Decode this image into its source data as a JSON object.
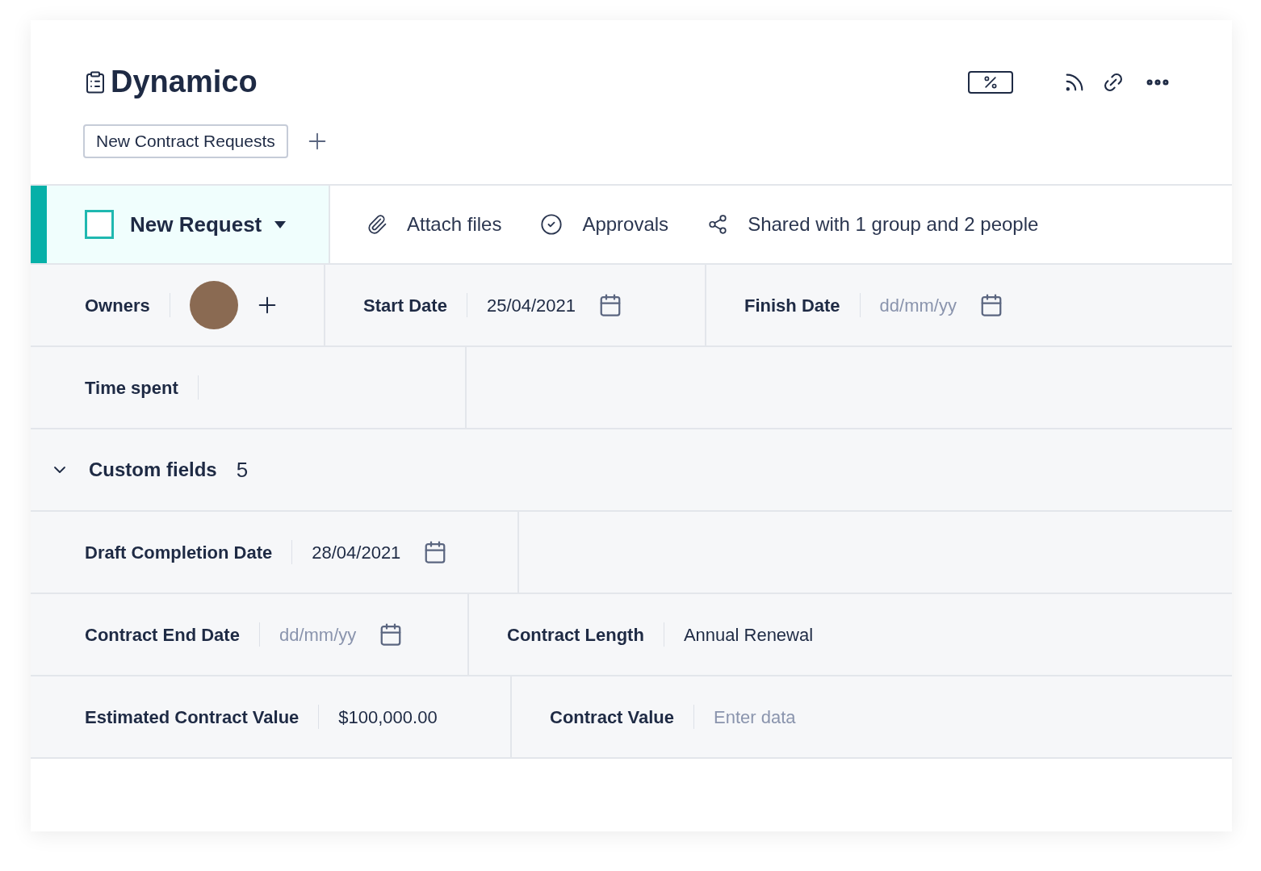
{
  "title": "Dynamico",
  "tags": [
    "New Contract Requests"
  ],
  "toolbar": {
    "checked": false,
    "status": "New Request",
    "actions": [
      {
        "kind": "attach",
        "label": "Attach files"
      },
      {
        "kind": "approvals",
        "label": "Approvals"
      },
      {
        "kind": "share",
        "label": "Shared with 1 group and 2 people"
      }
    ]
  },
  "rows": [
    [
      {
        "kind": "owners",
        "label": "Owners"
      },
      {
        "kind": "date",
        "label": "Start Date",
        "value": "25/04/2021"
      },
      {
        "kind": "date",
        "label": "Finish Date",
        "placeholder": "dd/mm/yy"
      }
    ],
    [
      {
        "kind": "text",
        "label": "Time spent"
      },
      {
        "kind": "empty"
      }
    ]
  ],
  "custom_fields": {
    "label": "Custom fields",
    "count": "5",
    "expanded": true,
    "rows": [
      [
        {
          "kind": "date",
          "label": "Draft Completion Date",
          "value": "28/04/2021"
        },
        {
          "kind": "empty"
        }
      ],
      [
        {
          "kind": "date",
          "label": "Contract End Date",
          "placeholder": "dd/mm/yy"
        },
        {
          "kind": "text",
          "label": "Contract Length",
          "value": "Annual Renewal"
        }
      ],
      [
        {
          "kind": "text",
          "label": "Estimated Contract Value",
          "value": "$100,000.00"
        },
        {
          "kind": "text",
          "label": "Contract Value",
          "placeholder": "Enter data"
        }
      ]
    ]
  }
}
